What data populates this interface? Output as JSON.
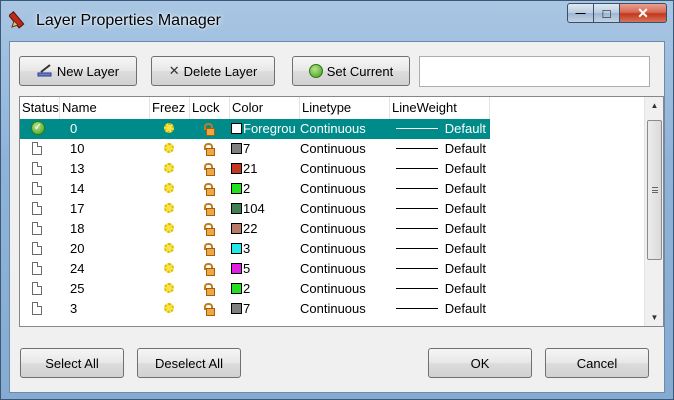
{
  "window": {
    "title": "Layer Properties Manager",
    "minimize_glyph": "—",
    "maximize_glyph": "□",
    "close_glyph": "✕"
  },
  "toolbar": {
    "new_layer": "New Layer",
    "delete_layer": "Delete Layer",
    "set_current": "Set Current",
    "delete_glyph": "✕",
    "layer_name_value": ""
  },
  "grid": {
    "headers": [
      "Status",
      "Name",
      "Freez",
      "Lock",
      "Color",
      "Linetype",
      "LineWeight"
    ],
    "rows": [
      {
        "name": "0",
        "color_label": "Foregrou",
        "color_hex": "#ffffff",
        "linetype": "Continuous",
        "lineweight": "Default",
        "current": true
      },
      {
        "name": "10",
        "color_label": "7",
        "color_hex": "#7f7f7f",
        "linetype": "Continuous",
        "lineweight": "Default",
        "current": false
      },
      {
        "name": "13",
        "color_label": "21",
        "color_hex": "#c0391f",
        "linetype": "Continuous",
        "lineweight": "Default",
        "current": false
      },
      {
        "name": "14",
        "color_label": "2",
        "color_hex": "#22e01f",
        "linetype": "Continuous",
        "lineweight": "Default",
        "current": false
      },
      {
        "name": "17",
        "color_label": "104",
        "color_hex": "#3e8050",
        "linetype": "Continuous",
        "lineweight": "Default",
        "current": false
      },
      {
        "name": "18",
        "color_label": "22",
        "color_hex": "#b87a66",
        "linetype": "Continuous",
        "lineweight": "Default",
        "current": false
      },
      {
        "name": "20",
        "color_label": "3",
        "color_hex": "#22e8e8",
        "linetype": "Continuous",
        "lineweight": "Default",
        "current": false
      },
      {
        "name": "24",
        "color_label": "5",
        "color_hex": "#e020e0",
        "linetype": "Continuous",
        "lineweight": "Default",
        "current": false
      },
      {
        "name": "25",
        "color_label": "2",
        "color_hex": "#22e01f",
        "linetype": "Continuous",
        "lineweight": "Default",
        "current": false
      },
      {
        "name": "3",
        "color_label": "7",
        "color_hex": "#7f7f7f",
        "linetype": "Continuous",
        "lineweight": "Default",
        "current": false
      }
    ],
    "scroll_up_glyph": "▲",
    "scroll_down_glyph": "▼",
    "check_glyph": "✓"
  },
  "footer": {
    "select_all": "Select All",
    "deselect_all": "Deselect All",
    "ok": "OK",
    "cancel": "Cancel"
  },
  "colors": {
    "selection": "#008b8b",
    "title_bar": "#a9c6e3",
    "close_button": "#c0391f"
  }
}
